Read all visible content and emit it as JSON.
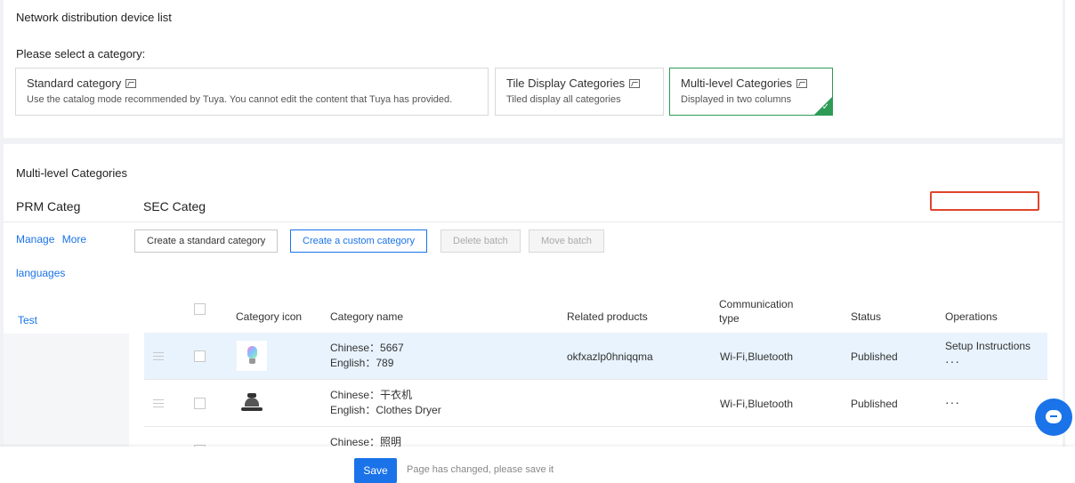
{
  "header": {
    "title": "Network distribution device list",
    "select_label": "Please select a category:"
  },
  "categories": [
    {
      "title": "Standard category",
      "desc": "Use the catalog mode recommended by Tuya. You cannot edit the content that Tuya has provided.",
      "selected": false
    },
    {
      "title": "Tile Display Categories",
      "desc": "Tiled display all categories",
      "selected": false
    },
    {
      "title": "Multi-level Categories",
      "desc": "Displayed in two columns",
      "selected": true
    }
  ],
  "multi": {
    "title": "Multi-level Categories",
    "prm_header": "PRM Categ",
    "sec_header": "SEC Categ",
    "manage": "Manage",
    "more_languages_1": "More",
    "more_languages_2": "languages",
    "prm_items": [
      "Test"
    ]
  },
  "toolbar": {
    "create_standard": "Create a standard category",
    "create_custom": "Create a custom category",
    "delete_batch": "Delete batch",
    "move_batch": "Move batch"
  },
  "table": {
    "headers": {
      "icon": "Category icon",
      "name": "Category name",
      "products": "Related products",
      "comm_1": "Communication",
      "comm_2": "type",
      "status": "Status",
      "operations": "Operations"
    },
    "rows": [
      {
        "icon": "light-bulb-icon",
        "name_cn": "Chinese：5667",
        "name_en": "English：789",
        "products": "okfxazlp0hniqqma",
        "comm": "Wi-Fi,Bluetooth",
        "status": "Published",
        "op_link": "Setup Instructions",
        "op_more": "···"
      },
      {
        "icon": "clothes-dryer-icon",
        "name_cn": "Chinese：干衣机",
        "name_en": "English：Clothes Dryer",
        "products": "",
        "comm": "Wi-Fi,Bluetooth",
        "status": "Published",
        "op_link": "",
        "op_more": "···"
      },
      {
        "icon": "",
        "name_cn": "Chinese：照明",
        "name_en": "",
        "products": "",
        "comm": "",
        "status": "",
        "op_link": "",
        "op_more": ""
      }
    ]
  },
  "footer": {
    "save_label": "Save",
    "hint": "Page has changed, please save it"
  },
  "colors": {
    "accent": "#1a73e8",
    "selected_border": "#2e9b55",
    "highlight_box": "#e0452b"
  }
}
